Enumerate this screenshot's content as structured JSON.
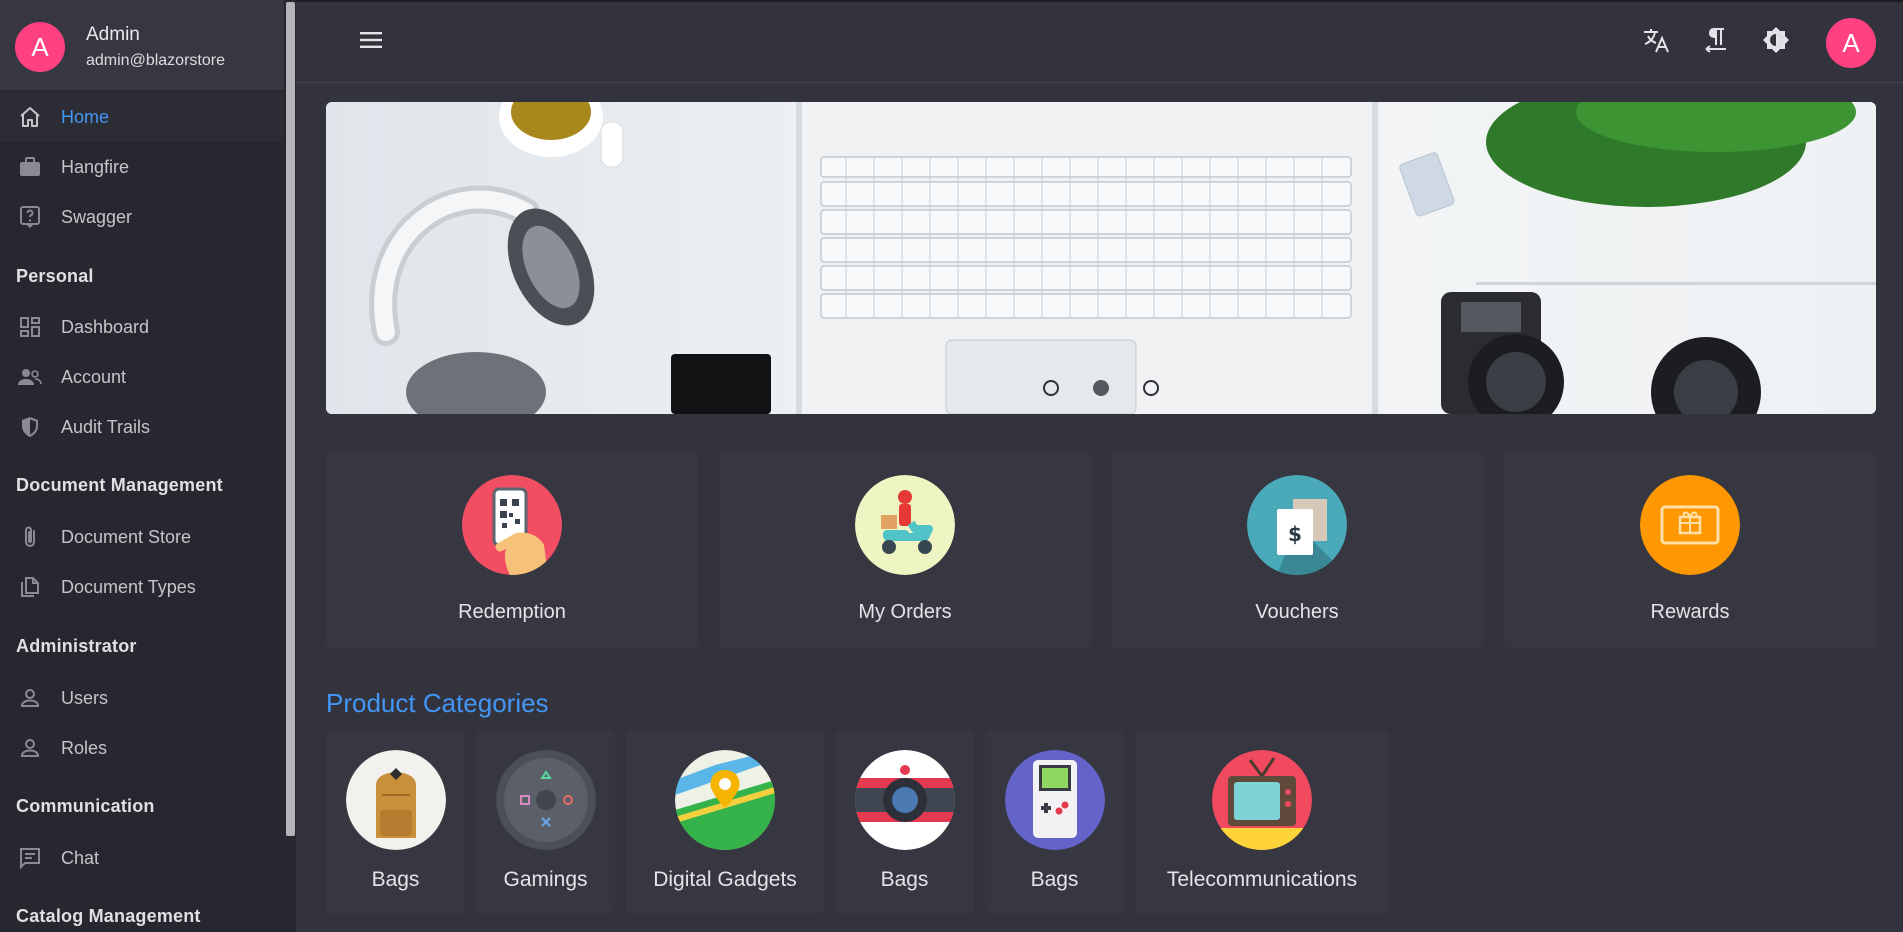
{
  "user": {
    "initial": "A",
    "name": "Admin",
    "email": "admin@blazorstore"
  },
  "colors": {
    "accent": "#4496f5",
    "avatar": "#ff4081",
    "sidebar_bg": "#27272f",
    "page_bg": "#32333d"
  },
  "nav": {
    "top_items": [
      {
        "label": "Home",
        "icon": "home-icon",
        "active": true
      },
      {
        "label": "Hangfire",
        "icon": "briefcase-icon"
      },
      {
        "label": "Swagger",
        "icon": "help-box-icon"
      }
    ],
    "sections": [
      {
        "title": "Personal",
        "items": [
          {
            "label": "Dashboard",
            "icon": "dashboard-icon"
          },
          {
            "label": "Account",
            "icon": "account-group-icon"
          },
          {
            "label": "Audit Trails",
            "icon": "shield-icon"
          }
        ]
      },
      {
        "title": "Document Management",
        "items": [
          {
            "label": "Document Store",
            "icon": "paperclip-icon"
          },
          {
            "label": "Document Types",
            "icon": "copy-icon"
          }
        ]
      },
      {
        "title": "Administrator",
        "items": [
          {
            "label": "Users",
            "icon": "person-icon"
          },
          {
            "label": "Roles",
            "icon": "person-icon"
          }
        ]
      },
      {
        "title": "Communication",
        "items": [
          {
            "label": "Chat",
            "icon": "chat-icon"
          }
        ]
      },
      {
        "title": "Catalog Management",
        "items": []
      }
    ]
  },
  "topbar": {
    "buttons": [
      "menu-icon",
      "translate-icon",
      "text-direction-icon",
      "theme-toggle-icon"
    ]
  },
  "banner": {
    "slides": 3,
    "active_slide": 2
  },
  "quick_links": [
    {
      "label": "Redemption",
      "icon": "qr-phone-icon"
    },
    {
      "label": "My Orders",
      "icon": "delivery-scooter-icon"
    },
    {
      "label": "Vouchers",
      "icon": "voucher-icon"
    },
    {
      "label": "Rewards",
      "icon": "gift-card-icon"
    }
  ],
  "categories": {
    "title": "Product Categories",
    "items": [
      {
        "label": "Bags",
        "icon": "backpack-icon"
      },
      {
        "label": "Gamings",
        "icon": "gamepad-icon"
      },
      {
        "label": "Digital Gadgets",
        "icon": "map-pin-icon"
      },
      {
        "label": "Bags",
        "icon": "camera-icon"
      },
      {
        "label": "Bags",
        "icon": "gameboy-icon"
      },
      {
        "label": "Telecommunications",
        "icon": "tv-icon"
      }
    ]
  }
}
